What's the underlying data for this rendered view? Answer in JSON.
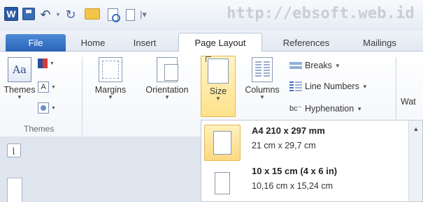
{
  "quick_access": {
    "app_icon_letter": "W"
  },
  "watermark": "http://ebsoft.web.id",
  "tabs": [
    {
      "label": "File"
    },
    {
      "label": "Home"
    },
    {
      "label": "Insert"
    },
    {
      "label": "Page Layout"
    },
    {
      "label": "References"
    },
    {
      "label": "Mailings"
    }
  ],
  "ribbon": {
    "themes": {
      "label": "Themes",
      "group_label": "Themes"
    },
    "margins": {
      "label": "Margins"
    },
    "orientation": {
      "label": "Orientation"
    },
    "size": {
      "label": "Size"
    },
    "columns": {
      "label": "Columns"
    },
    "breaks": {
      "label": "Breaks"
    },
    "line_numbers": {
      "label": "Line Numbers"
    },
    "hyphenation": {
      "label": "Hyphenation"
    },
    "cut_off": {
      "label": "Wat"
    }
  },
  "size_menu": {
    "items": [
      {
        "title": "A4 210 x 297 mm",
        "subtitle": "21 cm x 29,7 cm"
      },
      {
        "title": "10 x 15 cm (4 x 6 in)",
        "subtitle": "10,16 cm x 15,24 cm"
      }
    ]
  },
  "colors": {
    "file_tab": "#2a64b6",
    "selection": "#fde28a",
    "selection_border": "#e5b752"
  }
}
